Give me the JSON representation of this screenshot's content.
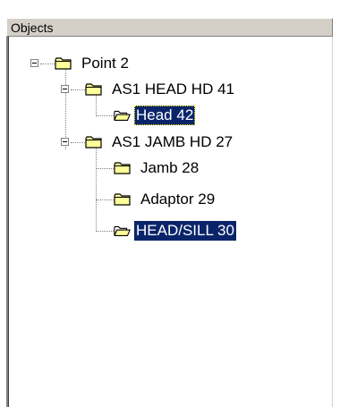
{
  "header": {
    "title": "Objects"
  },
  "tree": {
    "root": {
      "label": "Point 2",
      "expanded": true,
      "children": [
        {
          "label": "AS1 HEAD HD 41",
          "expanded": true,
          "children": [
            {
              "label": "Head 42",
              "open_folder": true,
              "state": "focused"
            }
          ]
        },
        {
          "label": "AS1 JAMB HD 27",
          "expanded": true,
          "children": [
            {
              "label": "Jamb 28",
              "open_folder": false,
              "state": "normal"
            },
            {
              "label": "Adaptor 29",
              "open_folder": false,
              "state": "normal"
            },
            {
              "label": "HEAD/SILL 30",
              "open_folder": true,
              "state": "selected"
            }
          ]
        }
      ]
    }
  },
  "colors": {
    "selection": "#0a246a",
    "folder_fill": "#ffff99",
    "folder_stroke": "#000000",
    "header_bg": "#d4d0c8"
  },
  "icons": {
    "closed_folder": "folder-icon",
    "open_folder": "folder-open-icon",
    "expander": "collapse-minus-icon"
  }
}
